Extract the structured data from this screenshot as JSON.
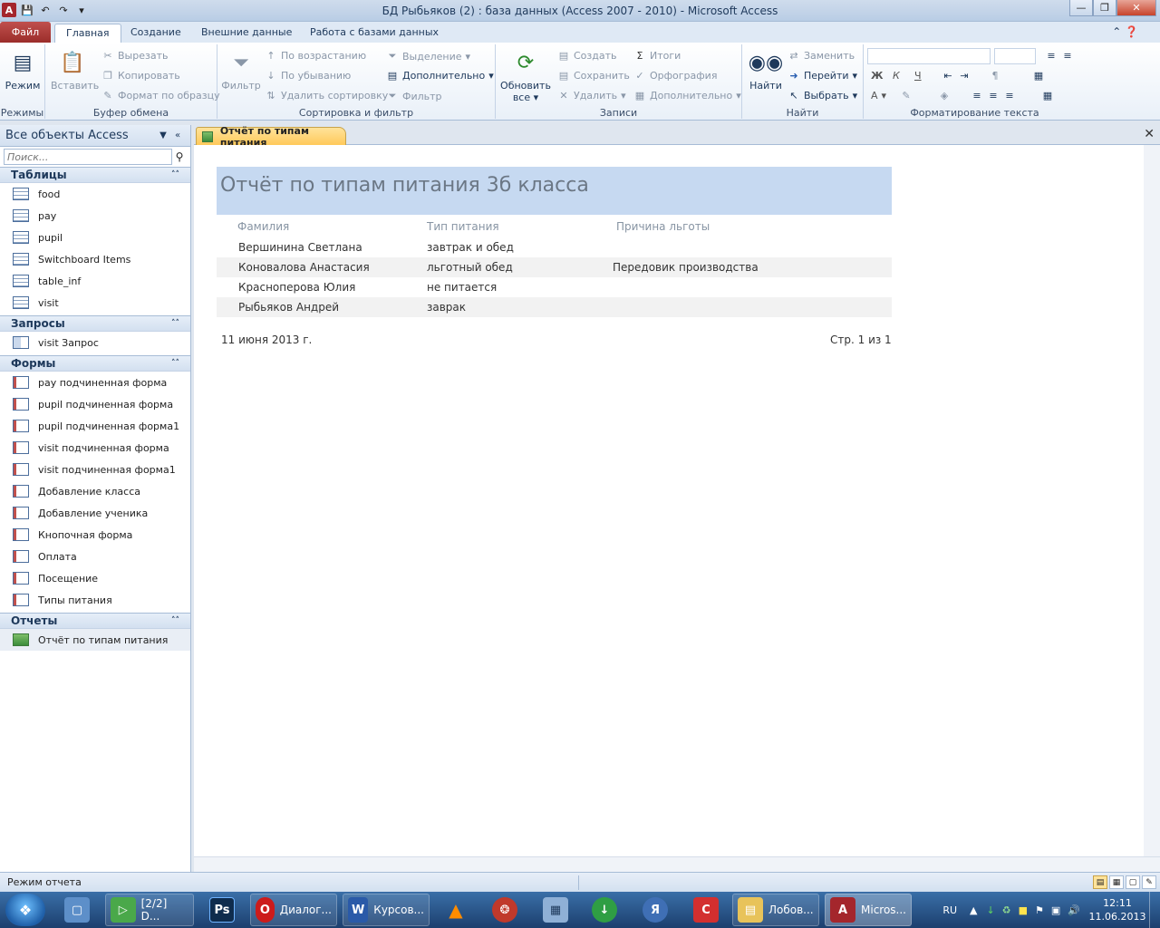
{
  "window": {
    "title": "БД Рыбьяков (2) : база данных (Access 2007 - 2010)  -  Microsoft Access"
  },
  "ribbon_tabs": [
    {
      "label": "Файл"
    },
    {
      "label": "Главная"
    },
    {
      "label": "Создание"
    },
    {
      "label": "Внешние данные"
    },
    {
      "label": "Работа с базами данных"
    }
  ],
  "ribbon": {
    "modes": {
      "button": "Режим",
      "group": "Режимы"
    },
    "clipboard": {
      "paste": "Вставить",
      "cut": "Вырезать",
      "copy": "Копировать",
      "format_painter": "Формат по образцу",
      "group": "Буфер обмена"
    },
    "sort_filter": {
      "filter": "Фильтр",
      "ascending": "По возрастанию",
      "descending": "По убыванию",
      "remove_sort": "Удалить сортировку",
      "selection": "Выделение",
      "advanced": "Дополнительно",
      "toggle_filter": "Фильтр",
      "group": "Сортировка и фильтр"
    },
    "records": {
      "refresh_line1": "Обновить",
      "refresh_line2": "все",
      "new": "Создать",
      "save": "Сохранить",
      "delete": "Удалить",
      "totals": "Итоги",
      "spelling": "Орфография",
      "more": "Дополнительно",
      "group": "Записи"
    },
    "find": {
      "find": "Найти",
      "replace": "Заменить",
      "goto": "Перейти",
      "select": "Выбрать",
      "group": "Найти"
    },
    "text_format": {
      "bold": "Ж",
      "italic": "К",
      "underline": "Ч",
      "font_color": "А",
      "group": "Форматирование текста"
    }
  },
  "nav": {
    "header": "Все объекты Access",
    "search_placeholder": "Поиск...",
    "sections": [
      {
        "title": "Таблицы",
        "items": [
          "food",
          "pay",
          "pupil",
          "Switchboard Items",
          "table_inf",
          "visit"
        ]
      },
      {
        "title": "Запросы",
        "items": [
          "visit Запрос"
        ]
      },
      {
        "title": "Формы",
        "items": [
          "pay подчиненная форма",
          "pupil подчиненная форма",
          "pupil подчиненная форма1",
          "visit подчиненная форма",
          "visit подчиненная форма1",
          "Добавление класса",
          "Добавление ученика",
          "Кнопочная форма",
          "Оплата",
          "Посещение",
          "Типы питания"
        ]
      },
      {
        "title": "Отчеты",
        "items": [
          "Отчёт по типам питания"
        ]
      }
    ]
  },
  "document": {
    "tab_label": "Отчёт по типам питания",
    "report": {
      "title": "Отчёт по типам питания 3б класса",
      "columns": [
        "Фамилия",
        "Тип питания",
        "Причина льготы"
      ],
      "rows": [
        [
          "Вершинина Светлана",
          "завтрак и обед",
          ""
        ],
        [
          "Коновалова Анастасия",
          "льготный обед",
          "Передовик производства"
        ],
        [
          "Красноперова Юлия",
          "не питается",
          ""
        ],
        [
          "Рыбьяков Андрей",
          "заврак",
          ""
        ]
      ],
      "date": "11 июня 2013 г.",
      "page": "Стр. 1 из 1"
    }
  },
  "status_bar": {
    "text": "Режим отчета"
  },
  "taskbar": {
    "items": [
      {
        "label": "[2/2] D..."
      },
      {
        "label": "Диалог..."
      },
      {
        "label": "Курсов..."
      },
      {
        "label": "Лобов..."
      },
      {
        "label": "Micros..."
      }
    ],
    "lang": "RU",
    "time": "12:11",
    "date": "11.06.2013"
  }
}
